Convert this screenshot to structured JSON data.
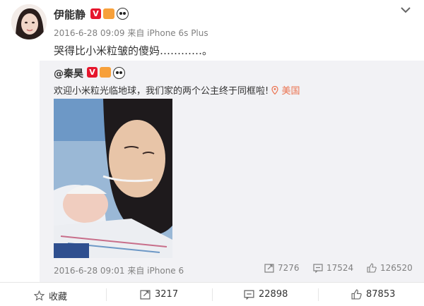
{
  "post": {
    "username": "伊能静",
    "timestamp": "2016-6-28 09:09",
    "source_prefix": "来自",
    "source": "iPhone 6s Plus",
    "text": "哭得比小米粒皱的傻妈…………。"
  },
  "repost": {
    "username": "@秦昊",
    "text": "欢迎小米粒光临地球，我们家的两个公主终于同框啦!",
    "location": "美国",
    "timestamp": "2016-6-28 09:01",
    "source_prefix": "来自",
    "source": "iPhone 6",
    "reposts": "7276",
    "comments": "17524",
    "likes": "126520"
  },
  "actions": {
    "favorite_label": "收藏",
    "reposts": "3217",
    "comments": "22898",
    "likes": "87853"
  },
  "icons": {
    "verified": "verified-v-icon",
    "crown": "crown-icon",
    "panda": "panda-icon",
    "menu": "chevron-down-icon",
    "location": "location-pin-icon",
    "repost": "repost-icon",
    "comment": "comment-icon",
    "like": "thumbs-up-icon",
    "favorite": "star-icon"
  },
  "colors": {
    "verified": "#e6162d",
    "location": "#eb7350",
    "meta": "#808080",
    "repost_bg": "#f2f2f5"
  }
}
